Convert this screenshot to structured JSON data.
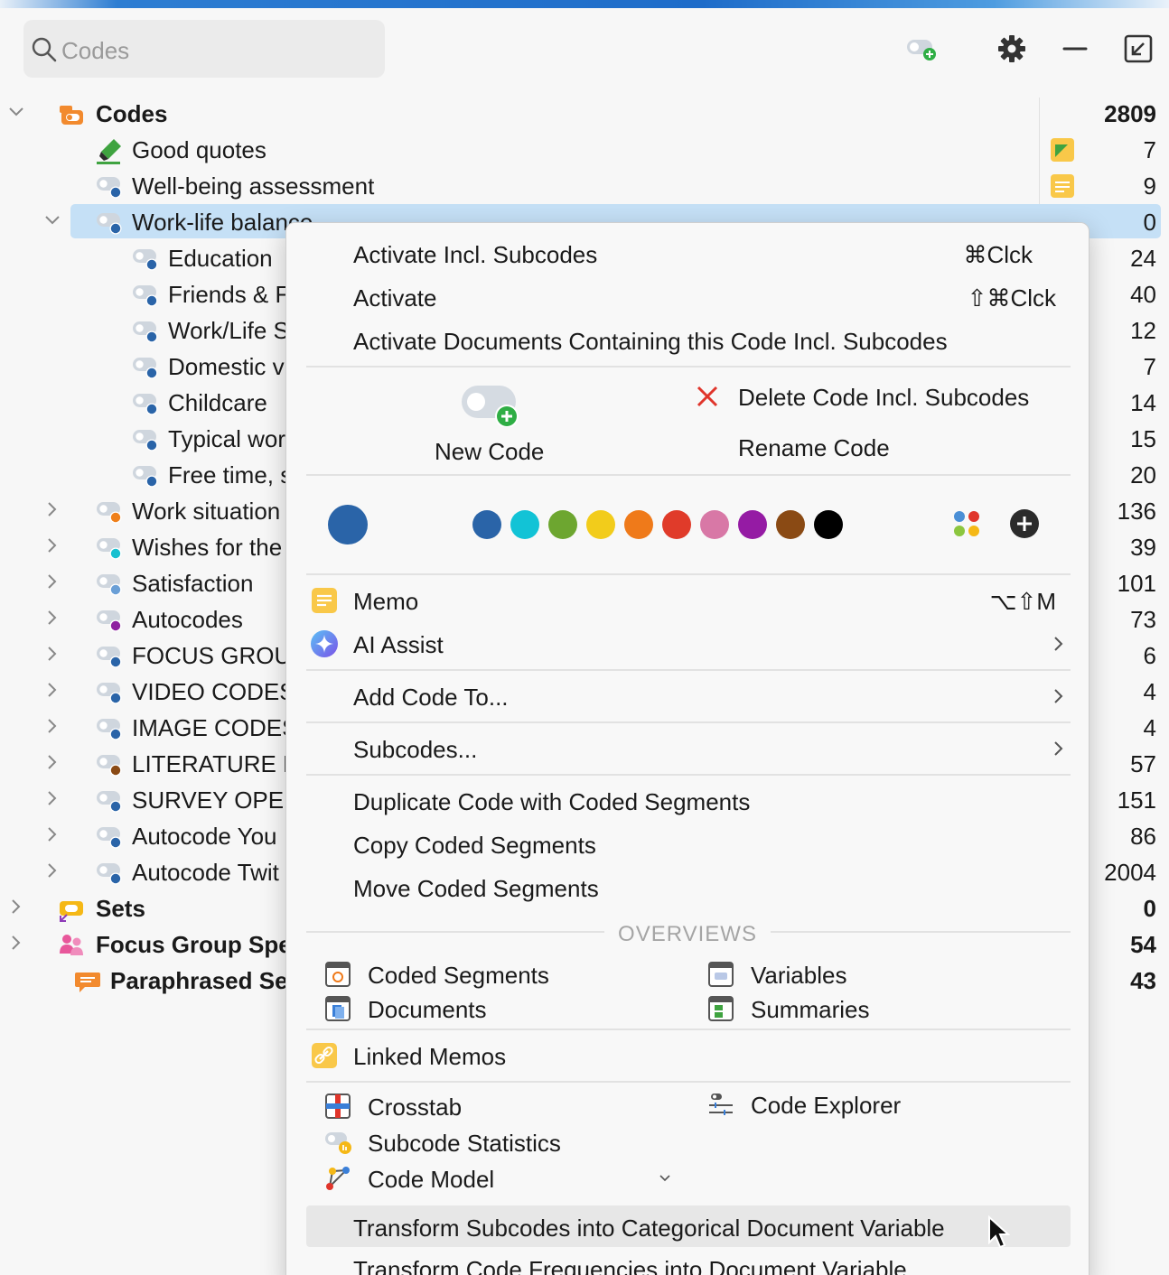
{
  "search": {
    "placeholder": "Codes"
  },
  "toolbar": {
    "new_code_icon": "new-code-icon",
    "settings_icon": "gear-icon",
    "minimize_icon": "minus-icon",
    "undock_icon": "undock-icon"
  },
  "tree": {
    "root": {
      "label": "Codes",
      "count": "2809"
    },
    "rows": [
      {
        "label": "Good quotes",
        "count": "7",
        "indent": 1,
        "expand": "",
        "color": "#63a832",
        "icon": "highlighter"
      },
      {
        "label": "Well-being assessment",
        "count": "9",
        "indent": 1,
        "expand": "",
        "color": "#2a64a8",
        "icon": "code"
      },
      {
        "label": "Work-life balance",
        "count": "0",
        "indent": 1,
        "expand": "open",
        "color": "#2a64a8",
        "icon": "code",
        "selected": true
      },
      {
        "label": "Education",
        "count": "24",
        "indent": 2,
        "expand": "",
        "color": "#2a64a8",
        "icon": "code"
      },
      {
        "label": "Friends & F",
        "count": "40",
        "indent": 2,
        "expand": "",
        "color": "#2a64a8",
        "icon": "code"
      },
      {
        "label": "Work/Life S",
        "count": "12",
        "indent": 2,
        "expand": "",
        "color": "#2a64a8",
        "icon": "code"
      },
      {
        "label": "Domestic v",
        "count": "7",
        "indent": 2,
        "expand": "",
        "color": "#2a64a8",
        "icon": "code"
      },
      {
        "label": "Childcare",
        "count": "14",
        "indent": 2,
        "expand": "",
        "color": "#2a64a8",
        "icon": "code"
      },
      {
        "label": "Typical wor",
        "count": "15",
        "indent": 2,
        "expand": "",
        "color": "#2a64a8",
        "icon": "code"
      },
      {
        "label": "Free time, s",
        "count": "20",
        "indent": 2,
        "expand": "",
        "color": "#2a64a8",
        "icon": "code"
      },
      {
        "label": "Work situation",
        "count": "136",
        "indent": 1,
        "expand": "closed",
        "color": "#ef7f1a",
        "icon": "code"
      },
      {
        "label": "Wishes for the",
        "count": "39",
        "indent": 1,
        "expand": "closed",
        "color": "#18c0d0",
        "icon": "code"
      },
      {
        "label": "Satisfaction",
        "count": "101",
        "indent": 1,
        "expand": "closed",
        "color": "#6a9fd6",
        "icon": "code"
      },
      {
        "label": "Autocodes",
        "count": "73",
        "indent": 1,
        "expand": "closed",
        "color": "#8e1fa0",
        "icon": "code"
      },
      {
        "label": "FOCUS GROU",
        "count": "6",
        "indent": 1,
        "expand": "closed",
        "color": "#2a64a8",
        "icon": "code"
      },
      {
        "label": "VIDEO CODES",
        "count": "4",
        "indent": 1,
        "expand": "closed",
        "color": "#2a64a8",
        "icon": "code"
      },
      {
        "label": "IMAGE CODES",
        "count": "4",
        "indent": 1,
        "expand": "closed",
        "color": "#2a64a8",
        "icon": "code"
      },
      {
        "label": "LITERATURE R",
        "count": "57",
        "indent": 1,
        "expand": "closed",
        "color": "#8a4a14",
        "icon": "code"
      },
      {
        "label": "SURVEY OPEN",
        "count": "151",
        "indent": 1,
        "expand": "closed",
        "color": "#2a64a8",
        "icon": "code"
      },
      {
        "label": "Autocode You",
        "count": "86",
        "indent": 1,
        "expand": "closed",
        "color": "#2a64a8",
        "icon": "code"
      },
      {
        "label": "Autocode Twit",
        "count": "2004",
        "indent": 1,
        "expand": "closed",
        "color": "#2a64a8",
        "icon": "code"
      }
    ],
    "sets": {
      "label": "Sets",
      "count": "0"
    },
    "focus": {
      "label": "Focus Group Spe",
      "count": "54"
    },
    "paraphrased": {
      "label": "Paraphrased Se",
      "count": "43"
    }
  },
  "menu": {
    "activate_incl": "Activate Incl. Subcodes",
    "activate_incl_sc": "⌘Clck",
    "activate": "Activate",
    "activate_sc": "⇧⌘Clck",
    "activate_docs": "Activate Documents Containing this Code Incl. Subcodes",
    "new_code": "New Code",
    "delete_code": "Delete Code Incl. Subcodes",
    "rename_code": "Rename Code",
    "current_color": "#2a64a8",
    "colors": [
      "#2a64a8",
      "#12c3d6",
      "#6da630",
      "#f2cc1b",
      "#ef7a1a",
      "#e03b2a",
      "#d878a6",
      "#951ba4",
      "#8a4a14",
      "#000000"
    ],
    "memo": "Memo",
    "memo_sc": "⌥⇧M",
    "ai_assist": "AI Assist",
    "add_code_to": "Add Code To...",
    "subcodes": "Subcodes...",
    "duplicate": "Duplicate Code with Coded Segments",
    "copy_segments": "Copy Coded Segments",
    "move_segments": "Move Coded Segments",
    "overviews_header": "OVERVIEWS",
    "coded_segments": "Coded Segments",
    "documents": "Documents",
    "variables": "Variables",
    "summaries": "Summaries",
    "linked_memos": "Linked Memos",
    "crosstab": "Crosstab",
    "code_explorer": "Code Explorer",
    "subcode_statistics": "Subcode Statistics",
    "code_model": "Code Model",
    "transform_categorical": "Transform Subcodes into Categorical Document Variable",
    "transform_frequencies": "Transform Code Frequencies into Document Variable"
  }
}
